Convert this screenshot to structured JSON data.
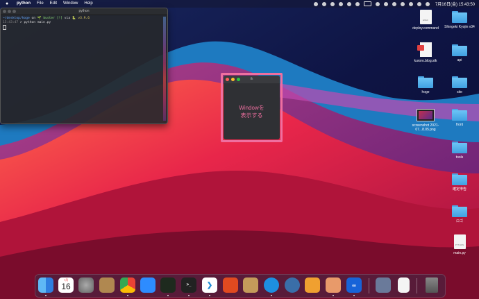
{
  "menubar": {
    "apple": "",
    "app_name": "python",
    "items": [
      "File",
      "Edit",
      "Window",
      "Help"
    ],
    "clock": "7月16日(金) 15:43:50"
  },
  "terminal": {
    "title": "python",
    "line1_path": "~/desktop/hoge",
    "line1_on": "on",
    "line1_branch": "🌱 buster [!]",
    "line1_via": "via",
    "line1_version": "🐍 v3.9.6",
    "line2_time": "15:43:47",
    "line2_cmd": "> python main.py"
  },
  "tk_window": {
    "title": "tk",
    "button_line1": "Windowを",
    "button_line2": "表示する"
  },
  "desktop_icons": [
    {
      "label": "deploy.command",
      "kind": "doc",
      "doc_label": "EXEC"
    },
    {
      "label": "Shingeki Kyojin v34",
      "kind": "folder"
    },
    {
      "label": "kuroro.blog.stk",
      "kind": "stk"
    },
    {
      "label": "api",
      "kind": "folder"
    },
    {
      "label": "hoge",
      "kind": "folder"
    },
    {
      "label": "site",
      "kind": "folder"
    },
    {
      "label": "screenshot 2021-07...8.05.png",
      "kind": "shot"
    },
    {
      "label": "front",
      "kind": "folder"
    },
    {
      "label": "tools",
      "kind": "folder"
    },
    {
      "label": "確定申告",
      "kind": "folder"
    },
    {
      "label": "ロゴ",
      "kind": "folder"
    },
    {
      "label": "main.py",
      "kind": "doc",
      "doc_label": "PYTHON"
    }
  ],
  "dock": {
    "calendar_month": "7月",
    "calendar_day": "16",
    "apps": [
      "finder",
      "calendar",
      "system-preferences",
      "contacts",
      "chrome",
      "zoom",
      "activity-monitor",
      "terminal",
      "vscode",
      "instruments",
      "archive-utility",
      "docker",
      "quicktime",
      "sourcetree",
      "preview-app",
      "infinity-app",
      "screenshot-thumb",
      "document",
      "trash"
    ]
  }
}
